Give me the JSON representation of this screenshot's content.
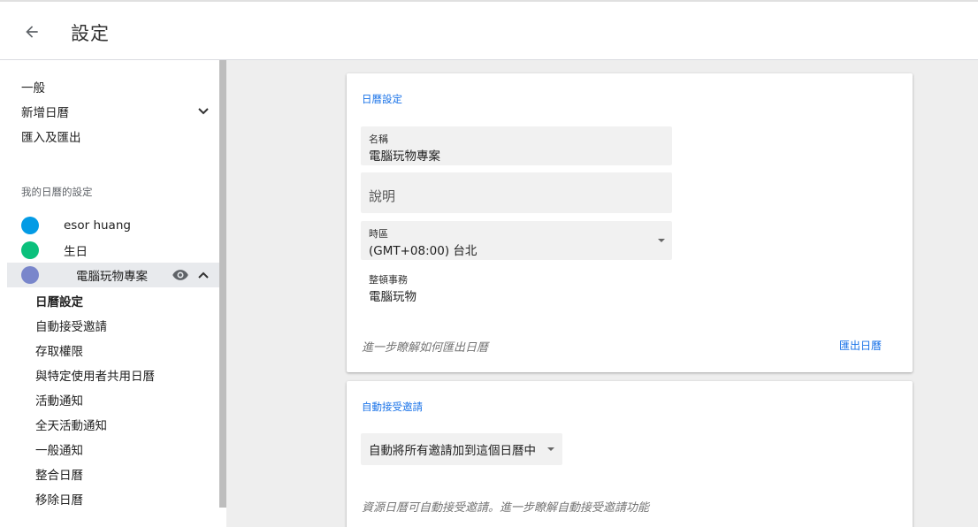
{
  "header": {
    "title": "設定",
    "back_icon": "arrow-back-icon"
  },
  "sidebar": {
    "top_items": [
      {
        "label": "一般"
      },
      {
        "label": "新增日曆"
      },
      {
        "label": "匯入及匯出"
      }
    ],
    "section_label": "我的日曆的設定",
    "calendars": [
      {
        "name": "esor huang",
        "color": "#039be5"
      },
      {
        "name": "生日",
        "color": "#0bc07c"
      },
      {
        "name": "電腦玩物專案",
        "color": "#7986cb"
      }
    ],
    "sub_items": [
      {
        "label": "日曆設定"
      },
      {
        "label": "自動接受邀請"
      },
      {
        "label": "存取權限"
      },
      {
        "label": "與特定使用者共用日曆"
      },
      {
        "label": "活動通知"
      },
      {
        "label": "全天活動通知"
      },
      {
        "label": "一般通知"
      },
      {
        "label": "整合日曆"
      },
      {
        "label": "移除日曆"
      }
    ]
  },
  "calendar_settings": {
    "title": "日曆設定",
    "name_label": "名稱",
    "name_value": "電腦玩物專案",
    "description_placeholder": "說明",
    "timezone_label": "時區",
    "timezone_value": "(GMT+08:00) 台北",
    "owner_label": "整頓事務",
    "owner_value": "電腦玩物",
    "learn_more": "進一步瞭解如何匯出日曆",
    "export_button": "匯出日曆"
  },
  "auto_accept": {
    "title": "自動接受邀請",
    "dropdown_value": "自動將所有邀請加到這個日曆中",
    "note": "資源日曆可自動接受邀請。進一步瞭解自動接受邀請功能"
  }
}
